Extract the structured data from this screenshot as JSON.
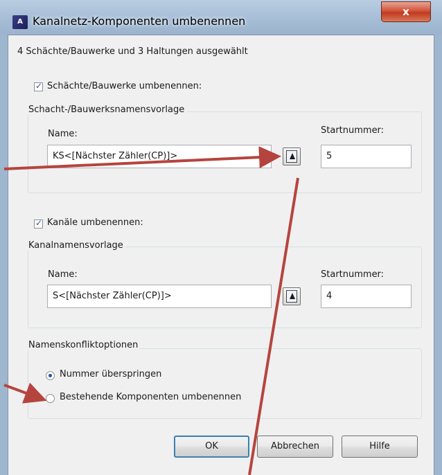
{
  "window": {
    "title": "Kanalnetz-Komponenten umbenennen",
    "close_label": "x"
  },
  "summary": "4 Schächte/Bauwerke und 3 Haltungen ausgewählt",
  "structures": {
    "checkbox_label": "Schächte/Bauwerke umbenennen:",
    "checked": true,
    "group_title": "Schacht-/Bauwerksnamensvorlage",
    "name_label": "Name:",
    "name_value": "KS<[Nächster Zähler(CP)]>",
    "start_label": "Startnummer:",
    "start_value": "5"
  },
  "pipes": {
    "checkbox_label": "Kanäle umbenennen:",
    "checked": true,
    "group_title": "Kanalnamensvorlage",
    "name_label": "Name:",
    "name_value": "S<[Nächster Zähler(CP)]>",
    "start_label": "Startnummer:",
    "start_value": "4"
  },
  "conflict": {
    "group_title": "Namenskonfliktoptionen",
    "options": [
      {
        "label": "Nummer überspringen",
        "selected": true
      },
      {
        "label": "Bestehende Komponenten umbenennen",
        "selected": false
      }
    ]
  },
  "buttons": {
    "ok": "OK",
    "cancel": "Abbrechen",
    "help": "Hilfe"
  },
  "colors": {
    "annotation_arrow": "#b6443e",
    "accent": "#2a4fa3"
  }
}
